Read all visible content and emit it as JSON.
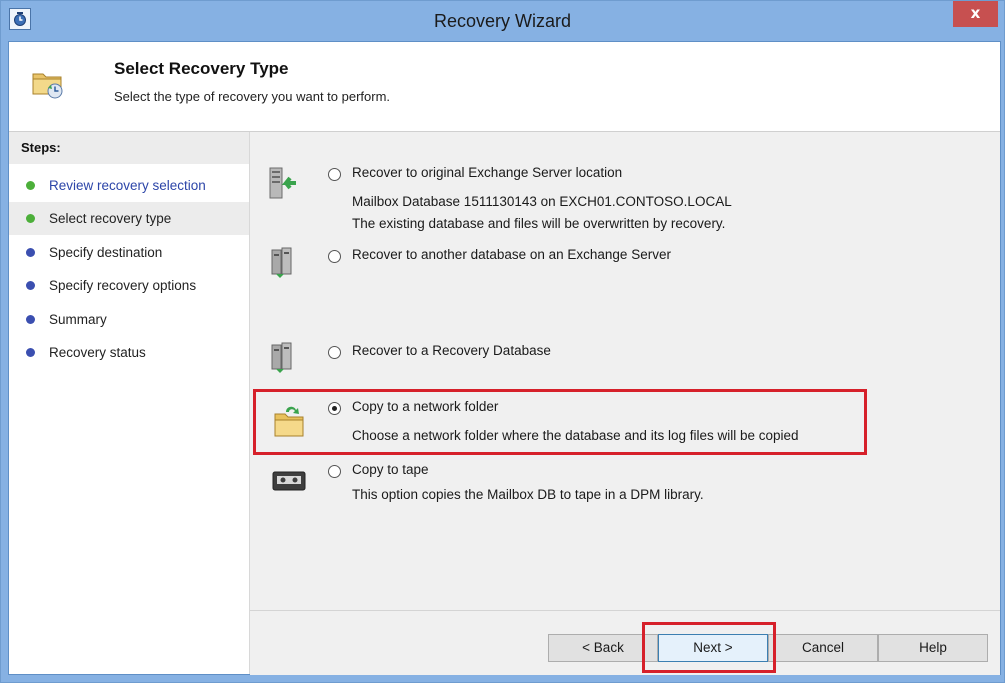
{
  "window": {
    "title": "Recovery Wizard",
    "close_label": "x"
  },
  "header": {
    "title": "Select Recovery Type",
    "subtitle": "Select the type of recovery you want to perform."
  },
  "steps": {
    "heading": "Steps:",
    "items": [
      {
        "label": "Review recovery selection",
        "state": "done"
      },
      {
        "label": "Select recovery type",
        "state": "current"
      },
      {
        "label": "Specify destination",
        "state": "pending"
      },
      {
        "label": "Specify recovery options",
        "state": "pending"
      },
      {
        "label": "Summary",
        "state": "pending"
      },
      {
        "label": "Recovery status",
        "state": "pending"
      }
    ]
  },
  "options": [
    {
      "label": "Recover to original Exchange Server location",
      "desc1": "Mailbox Database 1511130143 on EXCH01.CONTOSO.LOCAL",
      "desc2": "The existing database and files will be overwritten by recovery.",
      "icon": "server-restore-icon",
      "selected": false
    },
    {
      "label": "Recover to another database on an Exchange Server",
      "icon": "server-farm-icon",
      "selected": false
    },
    {
      "label": "Recover to a Recovery Database",
      "icon": "server-farm-icon",
      "selected": false
    },
    {
      "label": "Copy to a network folder",
      "desc1": "Choose a network folder where the database and its log files will be copied",
      "icon": "network-folder-icon",
      "selected": true
    },
    {
      "label": "Copy to tape",
      "desc1": "This option copies the Mailbox DB to tape in a DPM library.",
      "icon": "tape-icon",
      "selected": false
    }
  ],
  "buttons": {
    "back": "< Back",
    "next": "Next >",
    "cancel": "Cancel",
    "help": "Help"
  },
  "colors": {
    "highlight": "#d6202a",
    "titlebar": "#86b1e3",
    "step_done": "#4caf3a",
    "step_pending": "#3b4fb0"
  }
}
